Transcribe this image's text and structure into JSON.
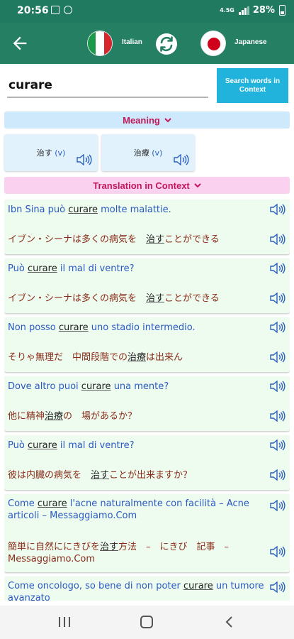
{
  "status": {
    "time": "20:56",
    "network": "4.5G",
    "battery": "28%"
  },
  "header": {
    "from_language": "Italian",
    "to_language": "Japanese"
  },
  "search": {
    "query": "curare",
    "context_button": "Search words in Context"
  },
  "meaning": {
    "header": "Meaning",
    "items": [
      {
        "word": "治す",
        "pos": "(v)"
      },
      {
        "word": "治療",
        "pos": "(v)"
      }
    ]
  },
  "context": {
    "header": "Translation in Context",
    "items": [
      {
        "it_pre": "Ibn Sina può ",
        "it_hl": "curare",
        "it_post": " molte malattie.",
        "ja_pre": "イブン・シーナは多くの病気を　",
        "ja_hl": "治す",
        "ja_post": "ことができる"
      },
      {
        "it_pre": "Può ",
        "it_hl": "curare",
        "it_post": " il mal di ventre?",
        "ja_pre": "イブン・シーナは多くの病気を　",
        "ja_hl": "治す",
        "ja_post": "ことができる"
      },
      {
        "it_pre": "Non posso ",
        "it_hl": "curare",
        "it_post": " uno stadio intermedio.",
        "ja_pre": "そりゃ無理だ　中間段階での",
        "ja_hl": "治療",
        "ja_post": "は出来ん"
      },
      {
        "it_pre": "Dove altro puoi ",
        "it_hl": "curare",
        "it_post": " una mente?",
        "ja_pre": "他に精神",
        "ja_hl": "治療",
        "ja_post": "の　場があるか？"
      },
      {
        "it_pre": "Può ",
        "it_hl": "curare",
        "it_post": " il mal di ventre?",
        "ja_pre": "彼は内臓の病気を　",
        "ja_hl": "治す",
        "ja_post": "ことが出来ますか？"
      },
      {
        "it_pre": "Come ",
        "it_hl": "curare",
        "it_post": " l'acne naturalmente con facilità – Acne articoli – Messaggiamo.Com",
        "ja_pre": "簡単に自然ににきびを",
        "ja_hl": "治す",
        "ja_post": "方法　–　にきび　記事　– Messaggiamo.Com"
      },
      {
        "it_pre": "Come oncologo, so bene di non poter ",
        "it_hl": "curare",
        "it_post": " un tumore avanzato",
        "ja_pre": "",
        "ja_hl": "",
        "ja_post": ""
      }
    ]
  },
  "colors": {
    "header_green": "#247f63",
    "status_green": "#1f7a60",
    "accent_blue": "#21b3dc",
    "meaning_bg": "#cde9fb",
    "context_header_bg": "#fbd1f0",
    "context_card_bg": "#edfcee"
  }
}
